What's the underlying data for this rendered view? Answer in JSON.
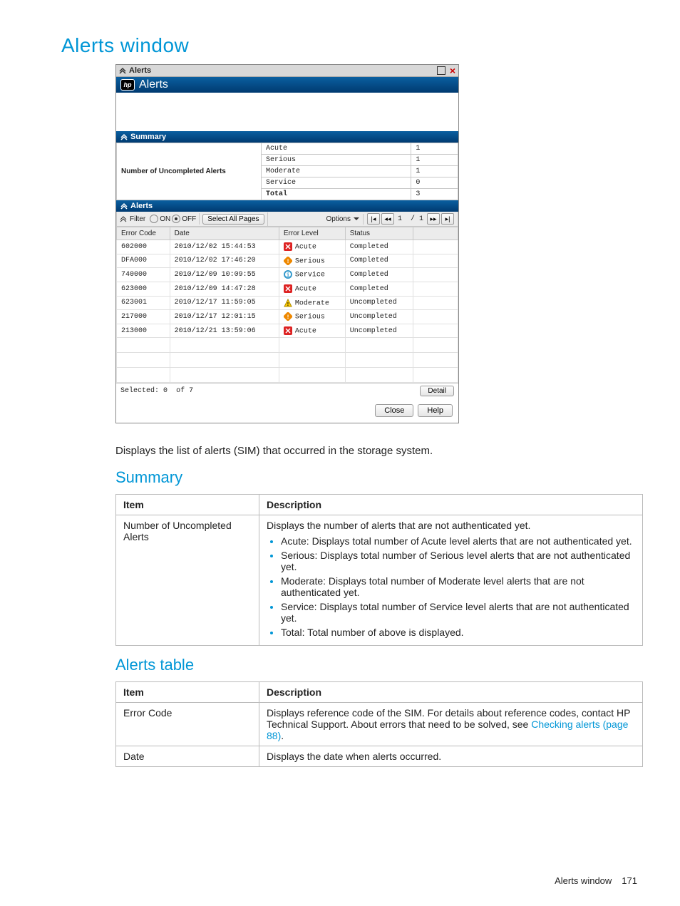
{
  "page_title": "Alerts window",
  "window": {
    "title": "Alerts",
    "brand": "Alerts",
    "panels": {
      "summary_label": "Summary",
      "alerts_label": "Alerts"
    },
    "summary": {
      "label": "Number of Uncompleted Alerts",
      "rows": [
        {
          "level": "Acute",
          "count": "1"
        },
        {
          "level": "Serious",
          "count": "1"
        },
        {
          "level": "Moderate",
          "count": "1"
        },
        {
          "level": "Service",
          "count": "0"
        },
        {
          "level": "Total",
          "count": "3"
        }
      ]
    },
    "toolbar": {
      "filter_label": "Filter",
      "on_label": "ON",
      "off_label": "OFF",
      "select_all_label": "Select All Pages",
      "options_label": "Options",
      "page_current": "1",
      "page_total": "1"
    },
    "grid": {
      "cols": {
        "c0": "Error Code",
        "c1": "Date",
        "c2": "Error Level",
        "c3": "Status"
      },
      "rows": [
        {
          "code": "602000",
          "date": "2010/12/02 15:44:53",
          "level": "Acute",
          "status": "Completed"
        },
        {
          "code": "DFA000",
          "date": "2010/12/02 17:46:20",
          "level": "Serious",
          "status": "Completed"
        },
        {
          "code": "740000",
          "date": "2010/12/09 10:09:55",
          "level": "Service",
          "status": "Completed"
        },
        {
          "code": "623000",
          "date": "2010/12/09 14:47:28",
          "level": "Acute",
          "status": "Completed"
        },
        {
          "code": "623001",
          "date": "2010/12/17 11:59:05",
          "level": "Moderate",
          "status": "Uncompleted"
        },
        {
          "code": "217000",
          "date": "2010/12/17 12:01:15",
          "level": "Serious",
          "status": "Uncompleted"
        },
        {
          "code": "213000",
          "date": "2010/12/21 13:59:06",
          "level": "Acute",
          "status": "Uncompleted"
        }
      ]
    },
    "status_foot": {
      "selected_label": "Selected:",
      "selected": "0",
      "of_label": "of",
      "total": "7",
      "detail_label": "Detail"
    },
    "buttons": {
      "close": "Close",
      "help": "Help"
    }
  },
  "caption": "Displays the list of alerts (SIM) that occurred in the storage system.",
  "summary_heading": "Summary",
  "summary_table": {
    "h_item": "Item",
    "h_desc": "Description",
    "item": "Number of Uncompleted Alerts",
    "desc_lead": "Displays the number of alerts that are not authenticated yet.",
    "bullets": [
      "Acute: Displays total number of Acute level alerts that are not authenticated yet.",
      "Serious: Displays total number of Serious level alerts that are not authenticated yet.",
      "Moderate: Displays total number of Moderate level alerts that are not authenticated yet.",
      "Service: Displays total number of Service level alerts that are not authenticated yet.",
      "Total: Total number of above is displayed."
    ]
  },
  "alerts_heading": "Alerts table",
  "alerts_table": {
    "h_item": "Item",
    "h_desc": "Description",
    "rows": [
      {
        "item": "Error Code",
        "desc_pre": "Displays reference code of the SIM. For details about reference codes, contact HP Technical Support. About errors that need to be solved, see ",
        "link": "Checking alerts (page 88)",
        "desc_post": "."
      },
      {
        "item": "Date",
        "desc_pre": "Displays the date when alerts occurred.",
        "link": "",
        "desc_post": ""
      }
    ]
  },
  "footer": {
    "title": "Alerts window",
    "page": "171"
  }
}
